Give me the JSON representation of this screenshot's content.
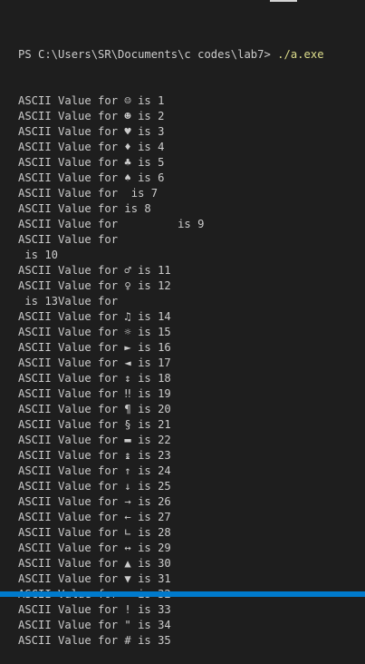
{
  "terminal": {
    "prompt": "PS C:\\Users\\SR\\Documents\\c codes\\lab7> ",
    "command": "./a.exe",
    "lines": [
      "ASCII Value for ☺ is 1",
      "ASCII Value for ☻ is 2",
      "ASCII Value for ♥ is 3",
      "ASCII Value for ♦ is 4",
      "ASCII Value for ♣ is 5",
      "ASCII Value for ♠ is 6",
      "ASCII Value for  is 7",
      "ASCII Value for is 8",
      "ASCII Value for         is 9",
      "ASCII Value for",
      " is 10",
      "ASCII Value for ♂ is 11",
      "ASCII Value for ♀ is 12",
      " is 13Value for",
      "ASCII Value for ♫ is 14",
      "ASCII Value for ☼ is 15",
      "ASCII Value for ► is 16",
      "ASCII Value for ◄ is 17",
      "ASCII Value for ↕ is 18",
      "ASCII Value for ‼ is 19",
      "ASCII Value for ¶ is 20",
      "ASCII Value for § is 21",
      "ASCII Value for ▬ is 22",
      "ASCII Value for ↨ is 23",
      "ASCII Value for ↑ is 24",
      "ASCII Value for ↓ is 25",
      "ASCII Value for → is 26",
      "ASCII Value for ← is 27",
      "ASCII Value for ∟ is 28",
      "ASCII Value for ↔ is 29",
      "ASCII Value for ▲ is 30",
      "ASCII Value for ▼ is 31",
      "ASCII Value for   is 32",
      "ASCII Value for ! is 33",
      "ASCII Value for \" is 34",
      "ASCII Value for # is 35"
    ]
  }
}
